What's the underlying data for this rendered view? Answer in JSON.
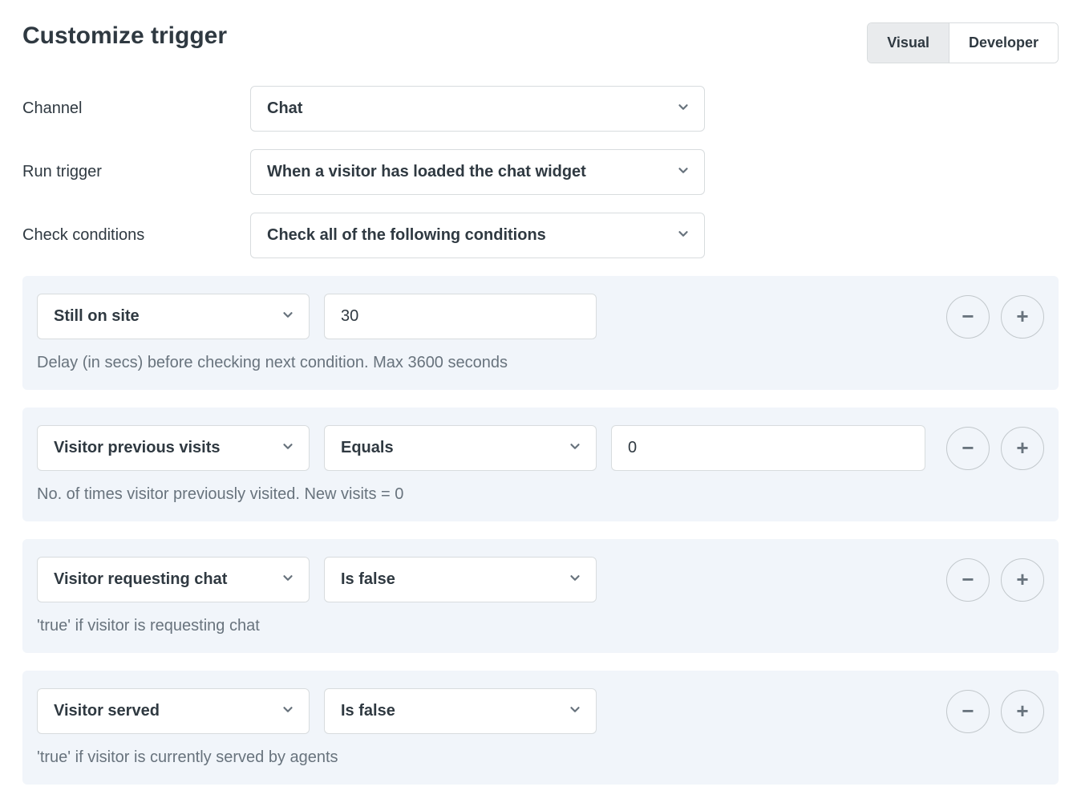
{
  "header": {
    "title": "Customize trigger",
    "tabs": [
      "Visual",
      "Developer"
    ],
    "activeTab": "Visual"
  },
  "form": {
    "channelLabel": "Channel",
    "channelValue": "Chat",
    "runTriggerLabel": "Run trigger",
    "runTriggerValue": "When a visitor has loaded the chat widget",
    "checkConditionsLabel": "Check conditions",
    "checkConditionsValue": "Check all of the following conditions"
  },
  "conditions": [
    {
      "field": "Still on site",
      "operator": null,
      "value": "30",
      "helper": "Delay (in secs) before checking next condition. Max 3600 seconds"
    },
    {
      "field": "Visitor previous visits",
      "operator": "Equals",
      "value": "0",
      "helper": "No. of times visitor previously visited. New visits = 0"
    },
    {
      "field": "Visitor requesting chat",
      "operator": "Is false",
      "value": null,
      "helper": "'true' if visitor is requesting chat"
    },
    {
      "field": "Visitor served",
      "operator": "Is false",
      "value": null,
      "helper": "'true' if visitor is currently served by agents"
    }
  ]
}
